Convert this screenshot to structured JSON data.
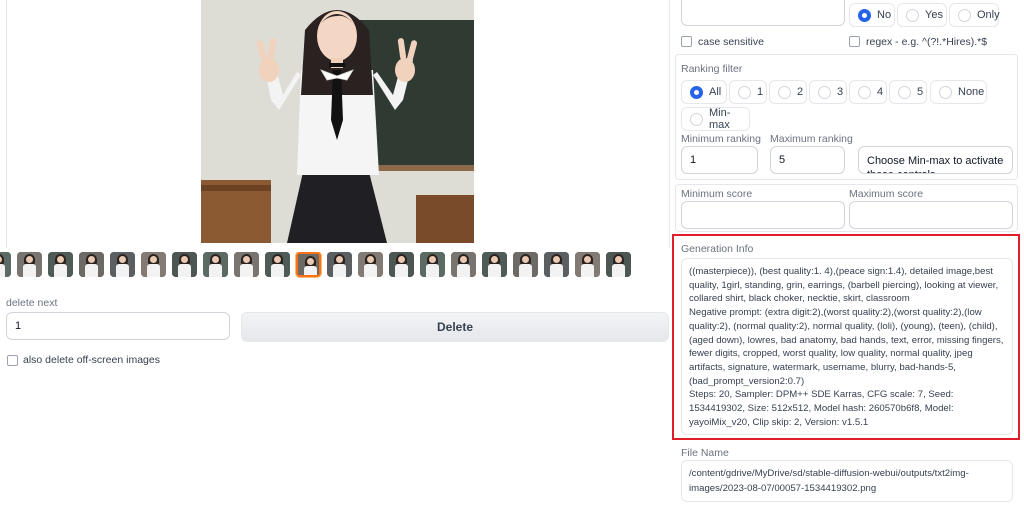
{
  "gallery": {
    "thumbnail_count": 21,
    "selected_index": 10
  },
  "delete_next": {
    "label": "delete next",
    "value": "1",
    "button_label": "Delete",
    "checkbox_label": "also delete off-screen images"
  },
  "search_options": {
    "hires_radio": [
      {
        "label": "No",
        "selected": true
      },
      {
        "label": "Yes",
        "selected": false
      },
      {
        "label": "Only",
        "selected": false
      }
    ],
    "case_sensitive_label": "case sensitive",
    "regex_label": "regex - e.g. ^(?!.*Hires).*$"
  },
  "ranking_filter": {
    "title": "Ranking filter",
    "options": [
      {
        "label": "All",
        "selected": true
      },
      {
        "label": "1",
        "selected": false
      },
      {
        "label": "2",
        "selected": false
      },
      {
        "label": "3",
        "selected": false
      },
      {
        "label": "4",
        "selected": false
      },
      {
        "label": "5",
        "selected": false
      },
      {
        "label": "None",
        "selected": false
      },
      {
        "label": "Min-max",
        "selected": false
      }
    ],
    "min_label": "Minimum ranking",
    "min_value": "1",
    "max_label": "Maximum ranking",
    "max_value": "5",
    "hint": "Choose Min-max to activate these controls"
  },
  "score": {
    "min_label": "Minimum score",
    "max_label": "Maximum score"
  },
  "generation_info": {
    "label": "Generation Info",
    "text": "((masterpiece)), (best quality:1. 4),(peace sign:1.4), detailed image,best quality, 1girl, standing, grin, earrings, (barbell piercing), looking at viewer, collared shirt, black choker, necktie, skirt, classroom\nNegative prompt: (extra digit:2),(worst quality:2),(worst quality:2),(low quality:2), (normal quality:2), normal quality, (loli), (young), (teen), (child), (aged down), lowres, bad anatomy, bad hands, text, error, missing fingers, fewer digits, cropped, worst quality, low quality, normal quality, jpeg artifacts, signature, watermark, username, blurry, bad-hands-5, (bad_prompt_version2:0.7)\nSteps: 20, Sampler: DPM++ SDE Karras, CFG scale: 7, Seed: 1534419302, Size: 512x512, Model hash: 260570b6f8, Model: yayoiMix_v20, Clip skip: 2, Version: v1.5.1"
  },
  "file_name": {
    "label": "File Name",
    "value": "/content/gdrive/MyDrive/sd/stable-diffusion-webui/outputs/txt2img-images/2023-08-07/00057-1534419302.png"
  },
  "colors": {
    "accent": "#2563eb",
    "highlight_box": "#e11d2a",
    "selected_thumb": "#f97316"
  }
}
